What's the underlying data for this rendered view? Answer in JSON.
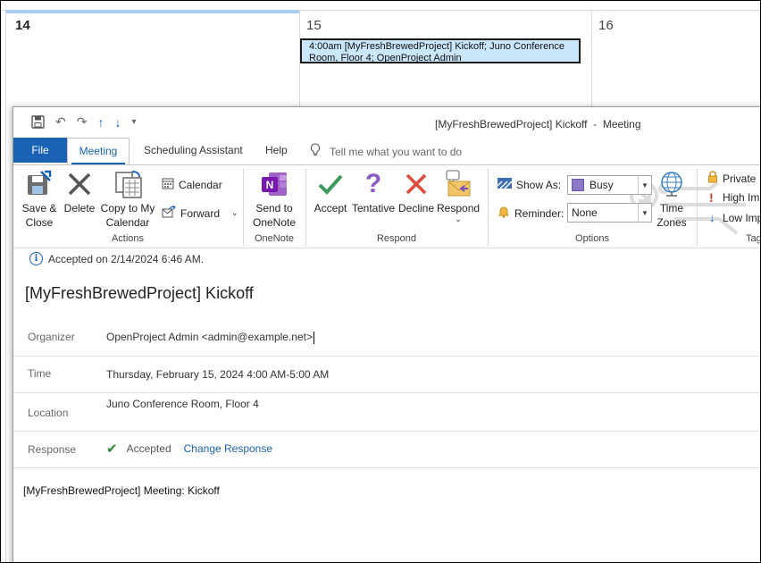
{
  "calendar": {
    "days": [
      "14",
      "15",
      "16"
    ],
    "appointment": "4:00am [MyFreshBrewedProject] Kickoff; Juno Conference Room, Floor 4; OpenProject Admin"
  },
  "window": {
    "title": "[MyFreshBrewedProject] Kickoff  -  Meeting"
  },
  "tabs": {
    "file": "File",
    "meeting": "Meeting",
    "scheduling": "Scheduling Assistant",
    "help": "Help",
    "tellme": "Tell me what you want to do"
  },
  "ribbon": {
    "actions": {
      "label": "Actions",
      "save_close": [
        "Save &",
        "Close"
      ],
      "delete": "Delete",
      "copy_calendar": [
        "Copy to My",
        "Calendar"
      ],
      "calendar": "Calendar",
      "forward": "Forward"
    },
    "onenote": {
      "label": "OneNote",
      "send": [
        "Send to",
        "OneNote"
      ]
    },
    "respond": {
      "label": "Respond",
      "accept": "Accept",
      "tentative": "Tentative",
      "decline": "Decline",
      "respond": "Respond"
    },
    "options": {
      "label": "Options",
      "show_as_label": "Show As:",
      "show_as_value": "Busy",
      "reminder_label": "Reminder:",
      "reminder_value": "None",
      "time_zones": [
        "Time",
        "Zones"
      ]
    },
    "tags": {
      "label": "Tag",
      "private": "Private",
      "high": "High Im",
      "low": "Low Imp"
    }
  },
  "info": "Accepted on 2/14/2024 6:46 AM.",
  "meeting": {
    "subject": "[MyFreshBrewedProject] Kickoff",
    "organizer_label": "Organizer",
    "organizer": "OpenProject Admin <admin@example.net>",
    "time_label": "Time",
    "time": "Thursday, February 15, 2024 4:00 AM-5:00 AM",
    "location_label": "Location",
    "location": "Juno Conference Room, Floor 4",
    "response_label": "Response",
    "response": "Accepted",
    "change_response": "Change Response",
    "body": "[MyFreshBrewedProject] Meeting: Kickoff"
  },
  "colors": {
    "accent": "#1a62b4",
    "appointment_bg": "#c9e6fb",
    "busy": "#8d77c7",
    "accept_green": "#2a8a3a",
    "decline_red": "#e04a3a",
    "tentative_purple": "#8a5bc7"
  }
}
